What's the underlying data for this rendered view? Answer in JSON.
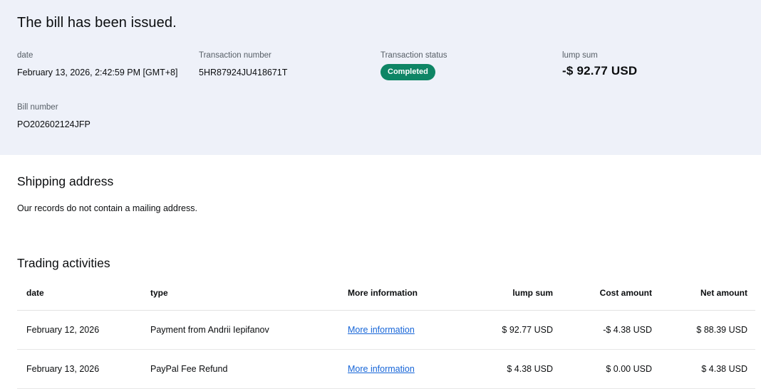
{
  "colors": {
    "hero_bg": "#eef1f9",
    "badge_green": "#0e8565",
    "link_blue": "#1665d8",
    "label_gray": "#565e66"
  },
  "hero": {
    "title": "The bill has been issued.",
    "fields": {
      "date": {
        "label": "date",
        "value": "February 13, 2026, 2:42:59 PM [GMT+8]"
      },
      "transaction_number": {
        "label": "Transaction number",
        "value": "5HR87924JU418671T"
      },
      "transaction_status": {
        "label": "Transaction status",
        "badge": "Completed"
      },
      "lump_sum": {
        "label": "lump sum",
        "value": "-$ 92.77 USD"
      },
      "bill_number": {
        "label": "Bill number",
        "value": "PO202602124JFP"
      }
    }
  },
  "shipping": {
    "heading": "Shipping address",
    "body": "Our records do not contain a mailing address."
  },
  "trading": {
    "heading": "Trading activities",
    "columns": {
      "date": "date",
      "type": "type",
      "more_info": "More information",
      "lump_sum": "lump sum",
      "cost": "Cost amount",
      "net": "Net amount"
    },
    "rows": [
      {
        "date": "February 12, 2026",
        "type": "Payment from Andrii Iepifanov",
        "link": "More information",
        "lump_sum": "$ 92.77 USD",
        "cost": "-$ 4.38 USD",
        "net": "$ 88.39 USD"
      },
      {
        "date": "February 13, 2026",
        "type": "PayPal Fee Refund",
        "link": "More information",
        "lump_sum": "$ 4.38 USD",
        "cost": "$ 0.00 USD",
        "net": "$ 4.38 USD"
      }
    ]
  }
}
